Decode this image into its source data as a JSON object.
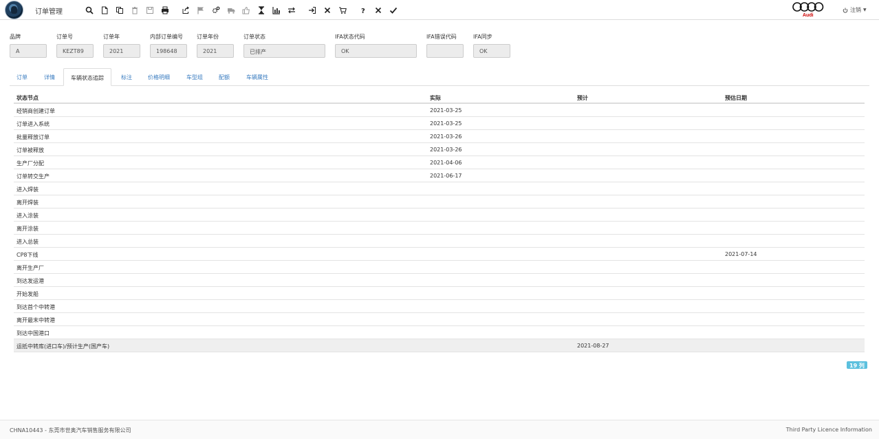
{
  "app": {
    "title": "订单管理",
    "logout_label": "注销"
  },
  "brand": {
    "logo_text": "Audi",
    "color": "#cc0000"
  },
  "toolbar": {
    "icons": [
      "search-icon",
      "new-document-icon",
      "copy-icon",
      "delete-icon",
      "save-icon",
      "print-icon",
      "share-icon",
      "flag-icon",
      "settings-icon",
      "truck-icon",
      "thumbs-up-icon",
      "hourglass-icon",
      "chart-icon",
      "swap-icon",
      "login-icon",
      "close-icon",
      "cart-icon",
      "help-icon",
      "cancel-icon",
      "confirm-icon"
    ]
  },
  "header_fields": [
    {
      "label": "品牌",
      "value": "A"
    },
    {
      "label": "订单号",
      "value": "KEZT89"
    },
    {
      "label": "订单年",
      "value": "2021"
    },
    {
      "label": "内部订单编号",
      "value": "198648"
    },
    {
      "label": "订单年份",
      "value": "2021"
    },
    {
      "label": "订单状态",
      "value": "已排产"
    },
    {
      "label": "IFA状态代码",
      "value": "OK"
    },
    {
      "label": "IFA错误代码",
      "value": ""
    },
    {
      "label": "IFA同步",
      "value": "OK"
    }
  ],
  "tabs": [
    "订单",
    "详情",
    "车辆状态追踪",
    "标注",
    "价格明细",
    "车型组",
    "配额",
    "车辆属性"
  ],
  "active_tab": "车辆状态追踪",
  "table": {
    "headers": [
      "状态节点",
      "实际",
      "预计",
      "预估日期"
    ],
    "rows": [
      [
        "经销商创建订单",
        "2021-03-25",
        "",
        ""
      ],
      [
        "订单进入系统",
        "2021-03-25",
        "",
        ""
      ],
      [
        "批量释放订单",
        "2021-03-26",
        "",
        ""
      ],
      [
        "订单被释放",
        "2021-03-26",
        "",
        ""
      ],
      [
        "生产厂分配",
        "2021-04-06",
        "",
        ""
      ],
      [
        "订单转交生产",
        "2021-06-17",
        "",
        ""
      ],
      [
        "进入焊装",
        "",
        "",
        ""
      ],
      [
        "离开焊装",
        "",
        "",
        ""
      ],
      [
        "进入涂装",
        "",
        "",
        ""
      ],
      [
        "离开涂装",
        "",
        "",
        ""
      ],
      [
        "进入总装",
        "",
        "",
        ""
      ],
      [
        "CP8下线",
        "",
        "",
        "2021-07-14"
      ],
      [
        "离开生产厂",
        "",
        "",
        ""
      ],
      [
        "到达发运港",
        "",
        "",
        ""
      ],
      [
        "开始发船",
        "",
        "",
        ""
      ],
      [
        "到达首个中转港",
        "",
        "",
        ""
      ],
      [
        "离开最末中转港",
        "",
        "",
        ""
      ],
      [
        "到达中国港口",
        "",
        "",
        ""
      ],
      [
        "运抵中转库(进口车)/预计生产(国产车)",
        "",
        "2021-08-27",
        ""
      ]
    ]
  },
  "row_count_label": "19 列",
  "footer": {
    "left": "CHNA10443 - 东莞市世奥汽车销售服务有限公司",
    "right": "Third Party Licence Information"
  },
  "colors": {
    "link": "#3a7cc0",
    "badge": "#5bc0de"
  }
}
